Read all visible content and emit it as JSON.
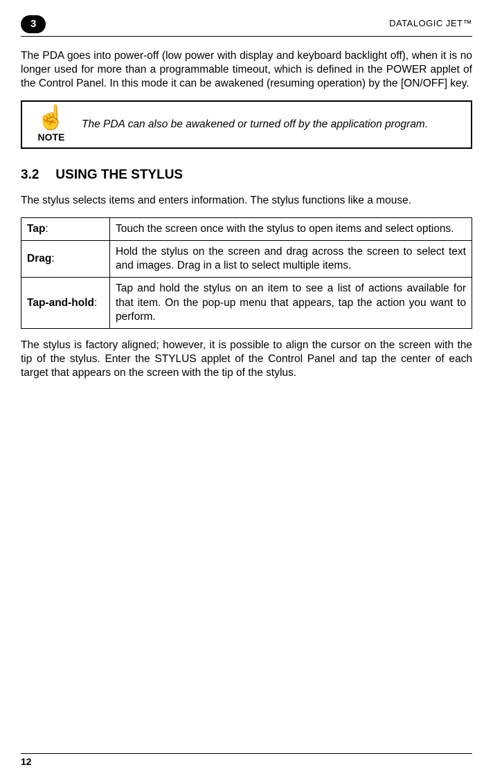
{
  "header": {
    "chapter_badge": "3",
    "product_title": "DATALOGIC JET™"
  },
  "intro_paragraph": "The PDA goes into power-off (low power with display and keyboard backlight off), when it is no longer used for more than a programmable timeout, which is defined in the POWER applet of the Control Panel. In this mode it can be awakened (resuming operation) by the [ON/OFF] key.",
  "note": {
    "icon_glyph": "☝",
    "label": "NOTE",
    "text": "The PDA can also be awakened or turned off by the application program."
  },
  "section": {
    "number": "3.2",
    "title": "USING THE STYLUS",
    "intro": "The stylus selects items and enters information. The stylus functions like a mouse.",
    "table": [
      {
        "term": "Tap",
        "desc": "Touch the screen once with the stylus to open items and select options."
      },
      {
        "term": "Drag",
        "desc": "Hold the stylus on the screen and drag across the screen to select text and images. Drag in a list to select multiple items."
      },
      {
        "term": "Tap-and-hold",
        "desc": "Tap and hold the stylus on an item to see a list of actions available for that item. On the pop-up menu that appears, tap the action you want to perform."
      }
    ],
    "outro": "The stylus is factory aligned; however, it is possible to align the cursor on the screen with the tip of the stylus. Enter the STYLUS applet of the Control Panel and tap the center of each target that appears on the screen with the tip of the stylus."
  },
  "footer": {
    "page_number": "12"
  }
}
